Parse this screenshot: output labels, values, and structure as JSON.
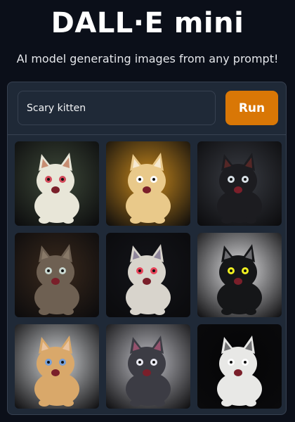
{
  "app": {
    "title": "DALL·E mini",
    "subtitle": "AI model generating images from any prompt!"
  },
  "prompt": {
    "value": "Scary kitten"
  },
  "run_button": {
    "label": "Run",
    "color": "#d97706"
  },
  "colors": {
    "background": "#0b0f19",
    "panel": "#1f2937",
    "border": "#374151"
  },
  "gallery": {
    "images": [
      {
        "name": "generated-image-1",
        "bg": "#3f4a3a",
        "cat": "#e8e6d8",
        "accent": "#b0522e",
        "eyes": "#d24a5a"
      },
      {
        "name": "generated-image-2",
        "bg": "#c98a1e",
        "cat": "#e9c98a",
        "accent": "#ffffff",
        "eyes": "#ffffff"
      },
      {
        "name": "generated-image-3",
        "bg": "#3a3d44",
        "cat": "#1c1c20",
        "accent": "#7a2f2c",
        "eyes": "#d8e0e6"
      },
      {
        "name": "generated-image-4",
        "bg": "#3b2a1d",
        "cat": "#6e6052",
        "accent": "#9a8a78",
        "eyes": "#c9d7d0"
      },
      {
        "name": "generated-image-5",
        "bg": "#14151a",
        "cat": "#d8d4cc",
        "accent": "#5e5078",
        "eyes": "#e8445a"
      },
      {
        "name": "generated-image-6",
        "bg": "#e2e2e4",
        "cat": "#151618",
        "accent": "#a7a7ab",
        "eyes": "#f0f020"
      },
      {
        "name": "generated-image-7",
        "bg": "#d4d6d8",
        "cat": "#d9a86a",
        "accent": "#f4d6c4",
        "eyes": "#77a0d8"
      },
      {
        "name": "generated-image-8",
        "bg": "#c0c0c6",
        "cat": "#3c3c44",
        "accent": "#d06088",
        "eyes": "#e8e8f0"
      },
      {
        "name": "generated-image-9",
        "bg": "#050506",
        "cat": "#e8e8e6",
        "accent": "#222226",
        "eyes": "#ffffff"
      }
    ]
  }
}
